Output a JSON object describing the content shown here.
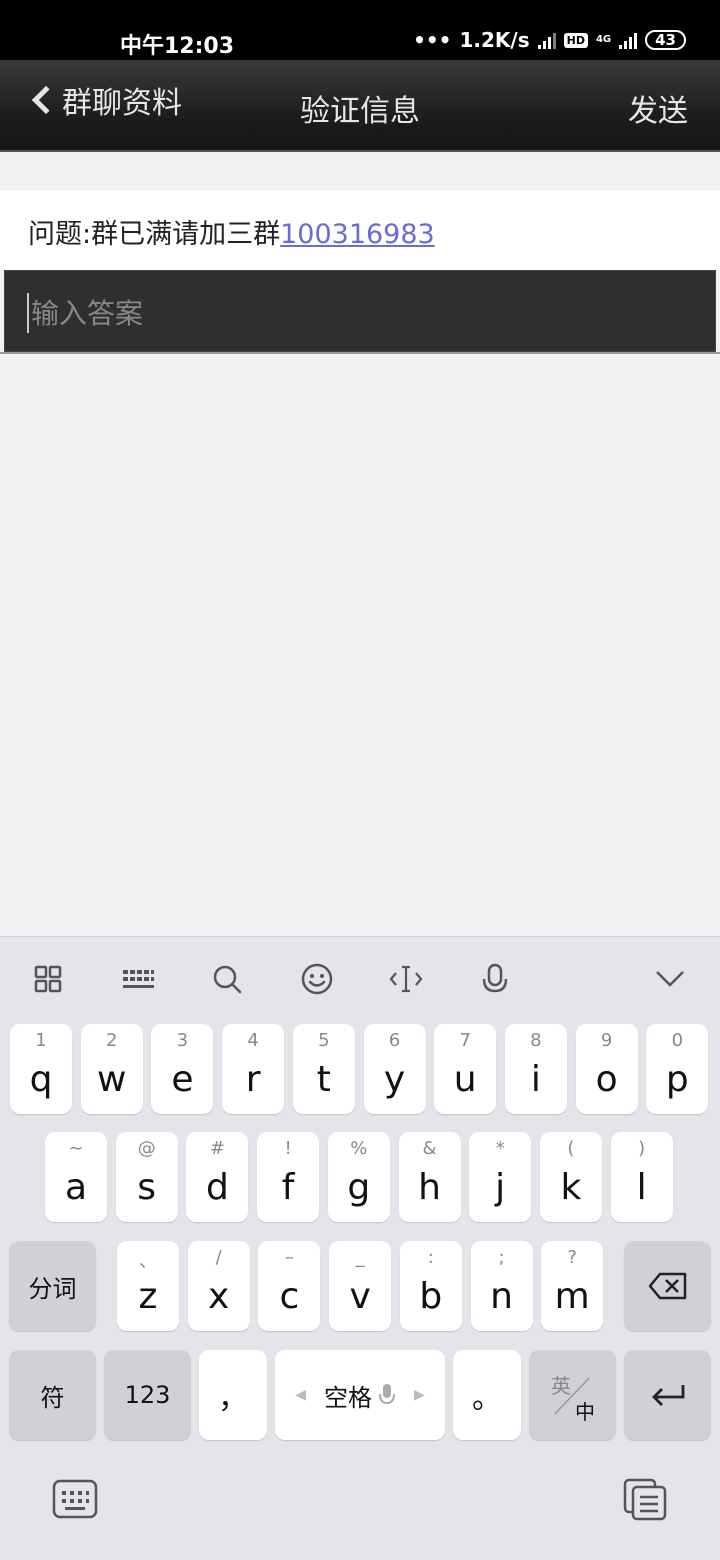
{
  "status_bar": {
    "time": "中午12:03",
    "net_speed": "1.2K/s",
    "hd": "HD",
    "network": "4G",
    "battery": "43"
  },
  "header": {
    "back_label": "群聊资料",
    "title": "验证信息",
    "send_label": "发送"
  },
  "question": {
    "prefix": "问题:群已满请加三群",
    "link_number": "100316983"
  },
  "answer": {
    "placeholder": "输入答案",
    "value": ""
  },
  "keyboard": {
    "toolbar_icons": [
      "apps-grid-icon",
      "keyboard-layout-icon",
      "search-icon",
      "emoji-icon",
      "cursor-icon",
      "microphone-icon",
      "collapse-chevron-icon"
    ],
    "row1": [
      {
        "sub": "1",
        "main": "q"
      },
      {
        "sub": "2",
        "main": "w"
      },
      {
        "sub": "3",
        "main": "e"
      },
      {
        "sub": "4",
        "main": "r"
      },
      {
        "sub": "5",
        "main": "t"
      },
      {
        "sub": "6",
        "main": "y"
      },
      {
        "sub": "7",
        "main": "u"
      },
      {
        "sub": "8",
        "main": "i"
      },
      {
        "sub": "9",
        "main": "o"
      },
      {
        "sub": "0",
        "main": "p"
      }
    ],
    "row2": [
      {
        "sub": "~",
        "main": "a"
      },
      {
        "sub": "@",
        "main": "s"
      },
      {
        "sub": "#",
        "main": "d"
      },
      {
        "sub": "!",
        "main": "f"
      },
      {
        "sub": "%",
        "main": "g"
      },
      {
        "sub": "&",
        "main": "h"
      },
      {
        "sub": "*",
        "main": "j"
      },
      {
        "sub": "(",
        "main": "k"
      },
      {
        "sub": ")",
        "main": "l"
      }
    ],
    "row3": [
      {
        "sub": "、",
        "main": "z"
      },
      {
        "sub": "/",
        "main": "x"
      },
      {
        "sub": "–",
        "main": "c"
      },
      {
        "sub": "_",
        "main": "v"
      },
      {
        "sub": ":",
        "main": "b"
      },
      {
        "sub": ";",
        "main": "n"
      },
      {
        "sub": "?",
        "main": "m"
      }
    ],
    "fenci": "分词",
    "fu": "符",
    "num": "123",
    "comma": "，",
    "space": "空格",
    "period": "。",
    "lang_top": "英",
    "lang_bottom": "中"
  }
}
